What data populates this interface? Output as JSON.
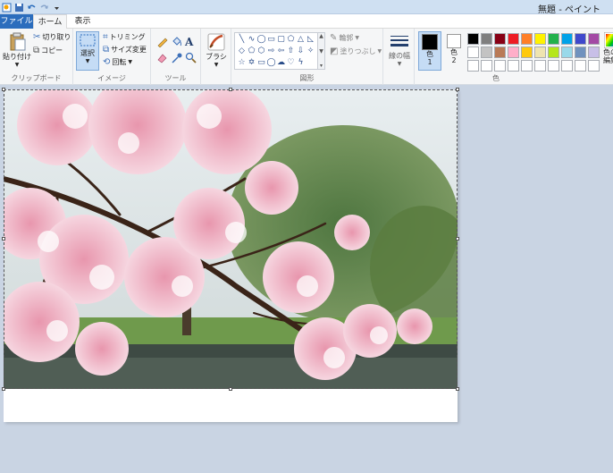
{
  "window": {
    "title": "無題 - ペイント"
  },
  "tabs": {
    "file": "ファイル",
    "home": "ホーム",
    "view": "表示"
  },
  "clipboard": {
    "paste": "貼り付け",
    "cut": "切り取り",
    "copy": "コピー",
    "group": "クリップボード"
  },
  "image": {
    "select": "選択",
    "crop": "トリミング",
    "resize": "サイズ変更",
    "rotate": "回転",
    "group": "イメージ"
  },
  "tools": {
    "group": "ツール",
    "text_glyph": "A"
  },
  "brushes": {
    "label": "ブラシ"
  },
  "shapes": {
    "outline": "輪郭",
    "fill": "塗りつぶし",
    "group": "図形"
  },
  "size": {
    "label": "線の幅"
  },
  "colors": {
    "color1": "色\n1",
    "color2": "色\n2",
    "edit": "色の\n編集",
    "group": "色",
    "color1_value": "#000000",
    "color2_value": "#ffffff",
    "palette": [
      "#000000",
      "#7f7f7f",
      "#880015",
      "#ed1c24",
      "#ff7f27",
      "#fff200",
      "#22b14c",
      "#00a2e8",
      "#3f48cc",
      "#a349a4",
      "#ffffff",
      "#c3c3c3",
      "#b97a57",
      "#ffaec9",
      "#ffc90e",
      "#efe4b0",
      "#b5e61d",
      "#99d9ea",
      "#7092be",
      "#c8bfe7",
      "#ffffff",
      "#ffffff",
      "#ffffff",
      "#ffffff",
      "#ffffff",
      "#ffffff",
      "#ffffff",
      "#ffffff",
      "#ffffff",
      "#ffffff"
    ]
  }
}
